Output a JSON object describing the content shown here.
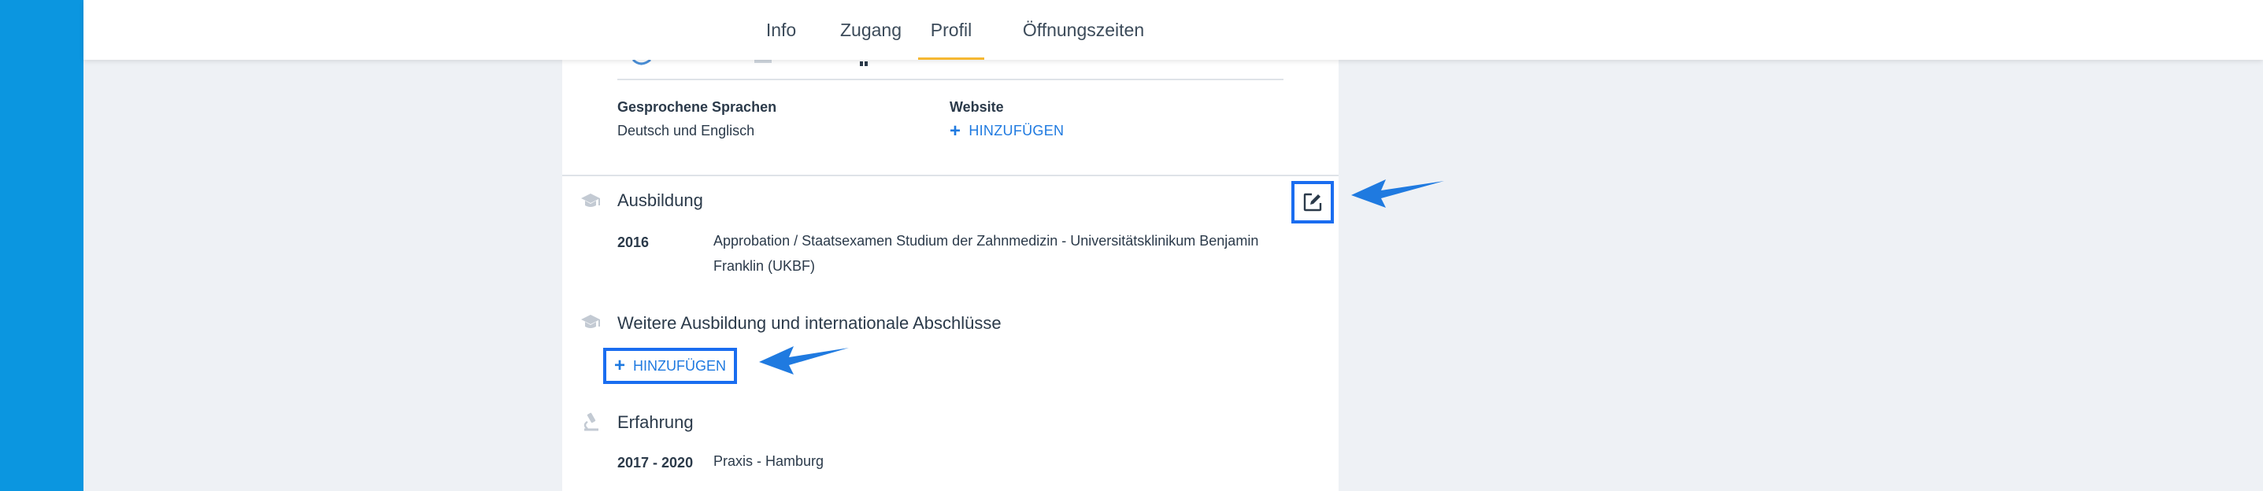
{
  "nav": {
    "tabs": [
      {
        "label": "Info"
      },
      {
        "label": "Zugang"
      },
      {
        "label": "Profil",
        "active": true
      },
      {
        "label": "Öffnungszeiten"
      }
    ]
  },
  "profile": {
    "languages_label": "Gesprochene Sprachen",
    "languages_value": "Deutsch und Englisch",
    "website_label": "Website",
    "website_add": "HINZUFÜGEN"
  },
  "education": {
    "title": "Ausbildung",
    "entries": [
      {
        "year": "2016",
        "text_line1": "Approbation / Staatsexamen Studium der Zahnmedizin - Universitätsklinikum Benjamin",
        "text_line2": "Franklin (UKBF)"
      }
    ]
  },
  "further_education": {
    "title": "Weitere Ausbildung und internationale Abschlüsse",
    "add_label": "HINZUFÜGEN"
  },
  "experience": {
    "title": "Erfahrung",
    "entries": [
      {
        "years": "2017 - 2020",
        "text": "Praxis - Hamburg"
      }
    ]
  },
  "colors": {
    "sidebar": "#0b96e0",
    "accent": "#1f7ae0",
    "highlight": "#1a6df0",
    "tab_underline": "#f5b731"
  },
  "icons": [
    "graduation-cap-icon",
    "microscope-icon",
    "edit-icon",
    "plus-icon",
    "arrow-pointer-icon"
  ]
}
